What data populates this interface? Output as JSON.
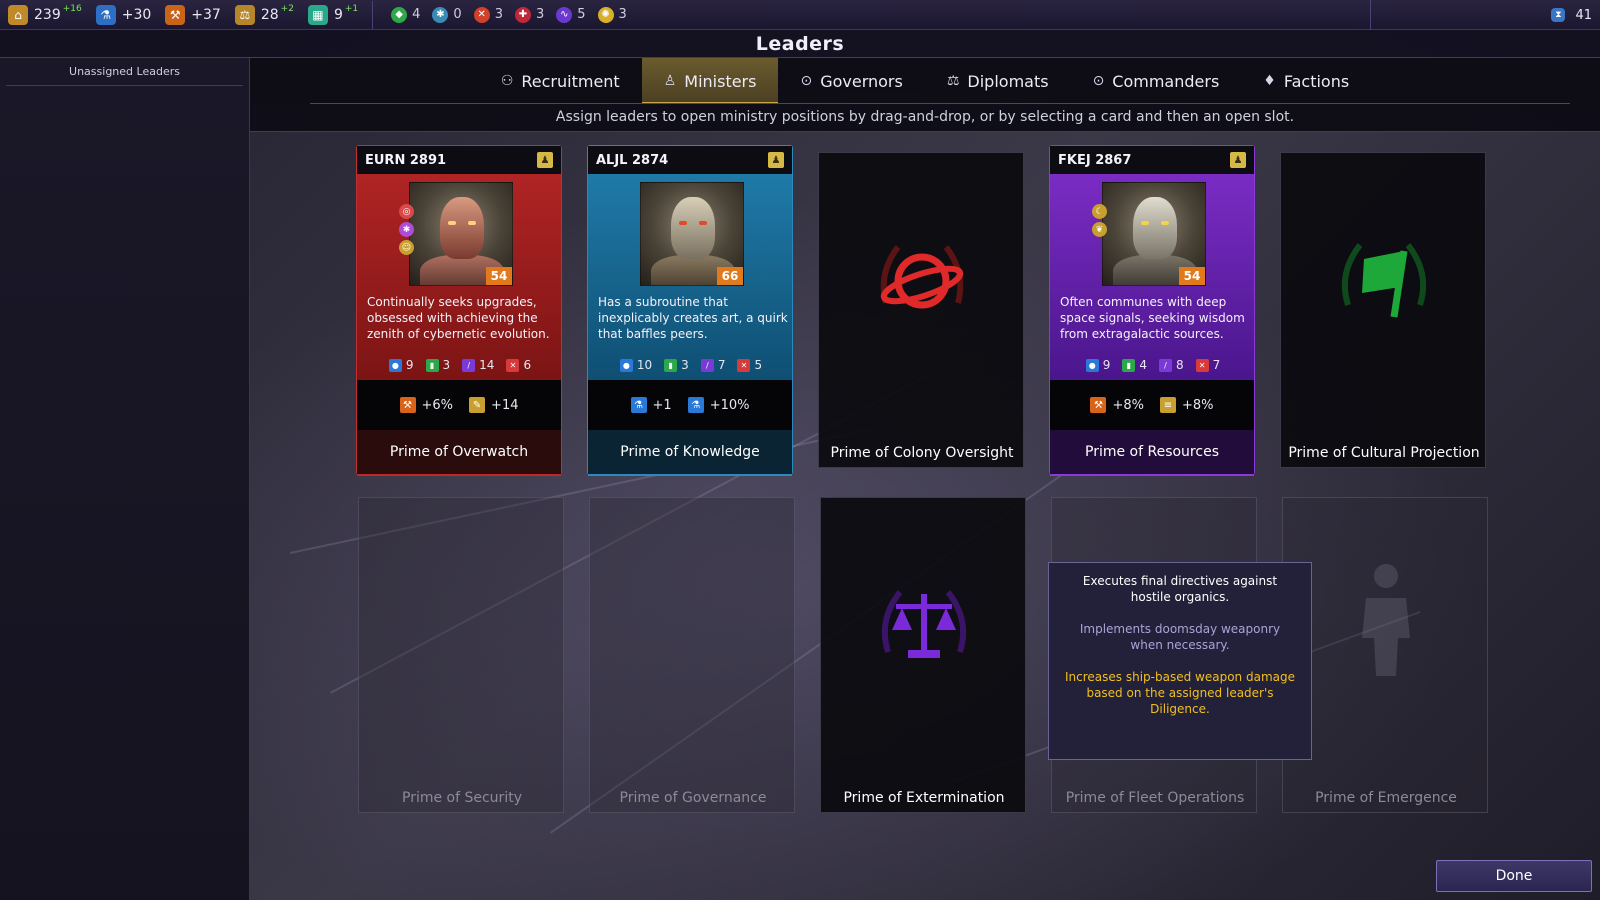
{
  "topbar": {
    "resources": [
      {
        "icon": "food-icon",
        "value": "239",
        "delta": "+16",
        "color": "#c08a2a",
        "glyph": "⌂"
      },
      {
        "icon": "science-icon",
        "value": "+30",
        "delta": "",
        "color": "#2d6fc4",
        "glyph": "⚗"
      },
      {
        "icon": "industry-icon",
        "value": "+37",
        "delta": "",
        "color": "#c8651a",
        "glyph": "⚒"
      },
      {
        "icon": "influence-icon",
        "value": "28",
        "delta": "+2",
        "color": "#b8862a",
        "glyph": "⚖"
      },
      {
        "icon": "population-icon",
        "value": "9",
        "delta": "+1",
        "color": "#2aa88a",
        "glyph": "▦"
      }
    ],
    "strategic": [
      {
        "icon": "titanium-icon",
        "value": "4",
        "color": "#2fa84a",
        "glyph": "◆"
      },
      {
        "icon": "crystal-icon",
        "value": "0",
        "color": "#3a8ab8",
        "glyph": "✱"
      },
      {
        "icon": "antimatter-icon",
        "value": "3",
        "color": "#d0402a",
        "glyph": "✕"
      },
      {
        "icon": "hyperium-icon",
        "value": "3",
        "color": "#c0283a",
        "glyph": "✚"
      },
      {
        "icon": "voidstone-icon",
        "value": "5",
        "color": "#6a3ad0",
        "glyph": "∿"
      },
      {
        "icon": "luxury-icon",
        "value": "3",
        "color": "#d8b028",
        "glyph": "✺"
      }
    ],
    "turn": "41"
  },
  "title": "Leaders",
  "sidebar": {
    "header": "Unassigned Leaders"
  },
  "tabs": [
    {
      "label": "Recruitment",
      "icon": "recruit-icon",
      "glyph": "⚇"
    },
    {
      "label": "Ministers",
      "icon": "minister-icon",
      "glyph": "♙"
    },
    {
      "label": "Governors",
      "icon": "governor-icon",
      "glyph": "⊙"
    },
    {
      "label": "Diplomats",
      "icon": "diplomat-icon",
      "glyph": "⚖"
    },
    {
      "label": "Commanders",
      "icon": "commander-icon",
      "glyph": "⊙"
    },
    {
      "label": "Factions",
      "icon": "faction-icon",
      "glyph": "♦"
    }
  ],
  "instructions": "Assign leaders to open ministry positions by drag-and-drop, or by selecting a card and then an open slot.",
  "filled_cards": [
    {
      "name": "EURN 2891",
      "level": "54",
      "theme": "red",
      "description": "Continually seeks upgrades, obsessed with achieving the zenith of cybernetic evolution.",
      "stats": [
        "9",
        "3",
        "14",
        "6"
      ],
      "bonuses": [
        {
          "icon": "industry-icon",
          "value": "+6%"
        },
        {
          "icon": "approval-icon",
          "value": "+14"
        }
      ],
      "position": "Prime of Overwatch"
    },
    {
      "name": "ALJL 2874",
      "level": "66",
      "theme": "blue",
      "description": "Has a subroutine that inexplicably creates art, a quirk that baffles peers.",
      "stats": [
        "10",
        "3",
        "7",
        "5"
      ],
      "bonuses": [
        {
          "icon": "science-icon",
          "value": "+1"
        },
        {
          "icon": "science-icon",
          "value": "+10%"
        }
      ],
      "position": "Prime of Knowledge"
    },
    {
      "name": "FKEJ 2867",
      "level": "54",
      "theme": "purple",
      "description": "Often communes with deep space signals, seeking wisdom from extragalactic sources.",
      "stats": [
        "9",
        "4",
        "8",
        "7"
      ],
      "bonuses": [
        {
          "icon": "industry-icon",
          "value": "+8%"
        },
        {
          "icon": "credits-icon",
          "value": "+8%"
        }
      ],
      "position": "Prime of Resources"
    }
  ],
  "open_slots": [
    {
      "position": "Prime of Colony Oversight",
      "emblem": "planet-icon",
      "color": "#e02a2a"
    },
    {
      "position": "Prime of Cultural Projection",
      "emblem": "flag-icon",
      "color": "#1fa83a"
    },
    {
      "position": "Prime of Extermination",
      "emblem": "scales-icon",
      "color": "#7a2ad8"
    }
  ],
  "locked_slots": [
    {
      "position": "Prime of Security"
    },
    {
      "position": "Prime of Governance"
    },
    {
      "position": "Prime of Fleet Operations"
    },
    {
      "position": "Prime of Emergence"
    }
  ],
  "tooltip": {
    "title": "Executes final directives against hostile organics.",
    "flavor": "Implements doomsday weaponry when necessary.",
    "effect": "Increases ship-based weapon damage based on the assigned leader's Diligence."
  },
  "done_label": "Done",
  "colors": {
    "accent": "#c9a84a",
    "panel": "#1a1828",
    "done": "#3e3868"
  }
}
